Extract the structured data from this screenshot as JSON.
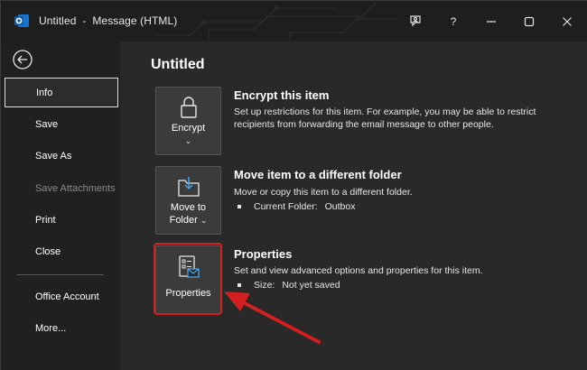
{
  "window": {
    "title": "Untitled  -  Message (HTML)",
    "app_icon": "outlook-icon",
    "help_label": "?",
    "controls": [
      "coaching-icon",
      "help-icon",
      "minimize-icon",
      "maximize-icon",
      "close-icon"
    ]
  },
  "sidebar": {
    "back_icon": "back-arrow-icon",
    "items": [
      {
        "label": "Info",
        "state": "active"
      },
      {
        "label": "Save",
        "state": "normal"
      },
      {
        "label": "Save As",
        "state": "normal"
      },
      {
        "label": "Save Attachments",
        "state": "disabled"
      },
      {
        "label": "Print",
        "state": "normal"
      },
      {
        "label": "Close",
        "state": "normal"
      },
      {
        "label": "Office Account",
        "state": "normal"
      },
      {
        "label": "More...",
        "state": "normal"
      }
    ]
  },
  "main": {
    "title": "Untitled",
    "sections": [
      {
        "tile_label": "Encrypt",
        "tile_icon": "lock-icon",
        "heading": "Encrypt this item",
        "description": "Set up restrictions for this item. For example, you may be able to restrict recipients from forwarding the email message to other people."
      },
      {
        "tile_label_line1": "Move to",
        "tile_label_line2": "Folder",
        "tile_icon": "move-to-folder-icon",
        "heading": "Move item to a different folder",
        "description": "Move or copy this item to a different folder.",
        "detail_label": "Current Folder:",
        "detail_value": "Outbox"
      },
      {
        "tile_label": "Properties",
        "tile_icon": "properties-icon",
        "heading": "Properties",
        "description": "Set and view advanced options and properties for this item.",
        "detail_label": "Size:",
        "detail_value": "Not yet saved"
      }
    ]
  },
  "colors": {
    "highlight": "#d21f1f",
    "background": "#292929",
    "sidebar": "#202020"
  }
}
